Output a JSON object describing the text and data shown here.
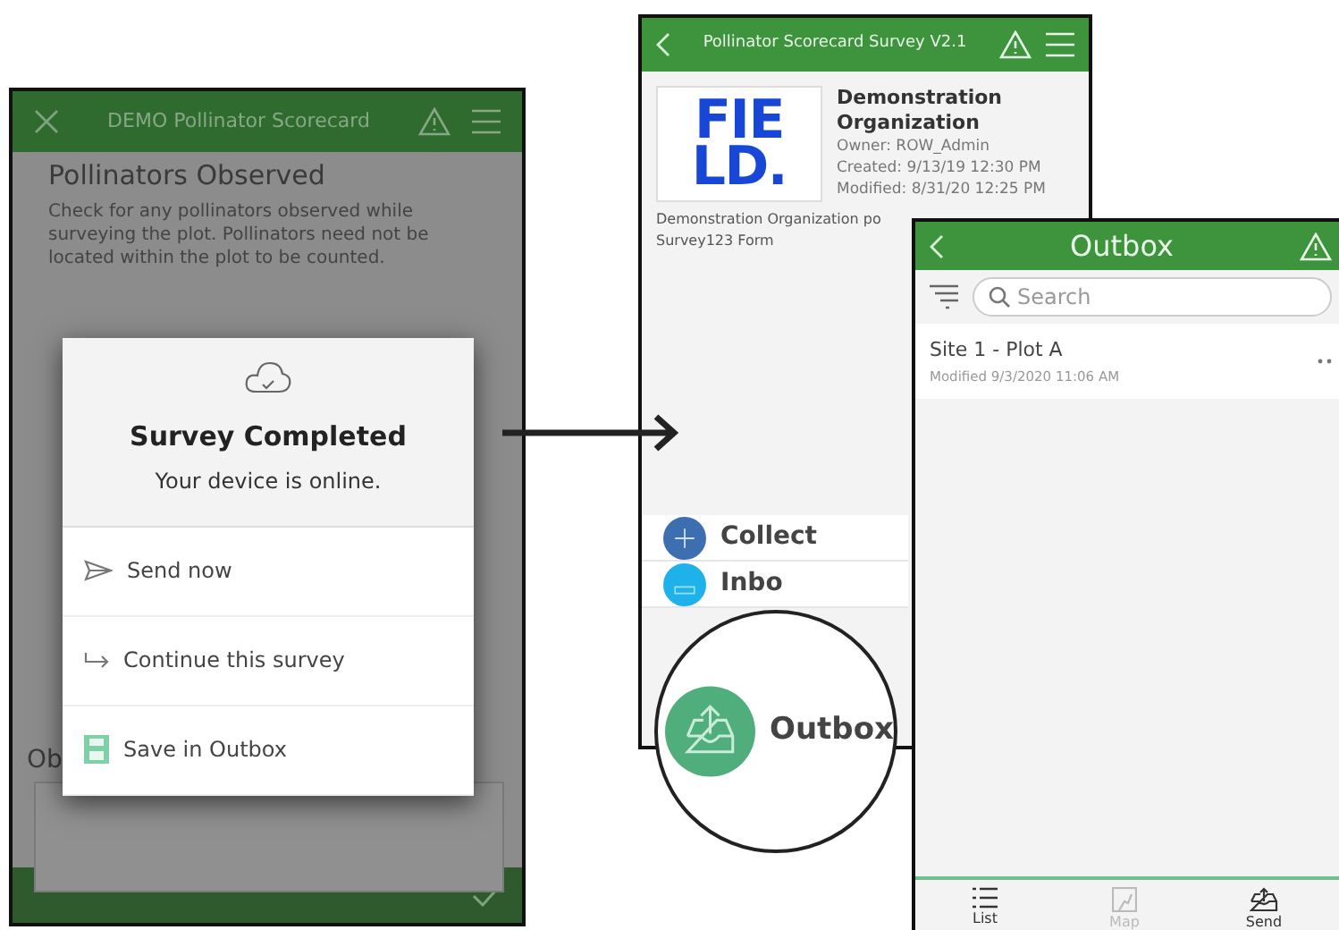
{
  "left_screen": {
    "title": "DEMO Pollinator Scorecard",
    "section_title": "Pollinators Observed",
    "hint": "Check for any pollinators observed while surveying the plot. Pollinators need not be located within the plot to be counted.",
    "label_partial": "Ob",
    "dialog": {
      "title": "Survey Completed",
      "message": "Your device is online.",
      "options": [
        {
          "kind": "send",
          "label": "Send now"
        },
        {
          "kind": "continue",
          "label": "Continue this survey"
        },
        {
          "kind": "save",
          "label": "Save in Outbox"
        }
      ]
    }
  },
  "middle_screen": {
    "title": "Pollinator Scorecard Survey V2.1",
    "logo": {
      "line_1": "FIE",
      "line_2": "LD."
    },
    "org_name": "Demonstration Organization",
    "owner": "Owner: ROW_Admin",
    "created": "Created: 9/13/19 12:30 PM",
    "modified": "Modified: 8/31/20 12:25 PM",
    "description": "Demonstration Organization po",
    "form_name": "Survey123 Form",
    "actions": [
      {
        "kind": "collect",
        "label": "Collect"
      },
      {
        "kind": "inbox",
        "label": "Inbo"
      }
    ],
    "magnified": {
      "kind": "outbox",
      "label": "Outbox"
    }
  },
  "right_screen": {
    "title": "Outbox",
    "search": {
      "placeholder": "Search"
    },
    "items": [
      {
        "title": "Site 1 - Plot A",
        "subtitle": "Modified 9/3/2020 11:06 AM"
      }
    ],
    "tabs": [
      {
        "kind": "list",
        "label": "List",
        "disabled": false
      },
      {
        "kind": "map",
        "label": "Map",
        "disabled": true
      },
      {
        "kind": "send",
        "label": "Send",
        "disabled": false
      }
    ]
  }
}
